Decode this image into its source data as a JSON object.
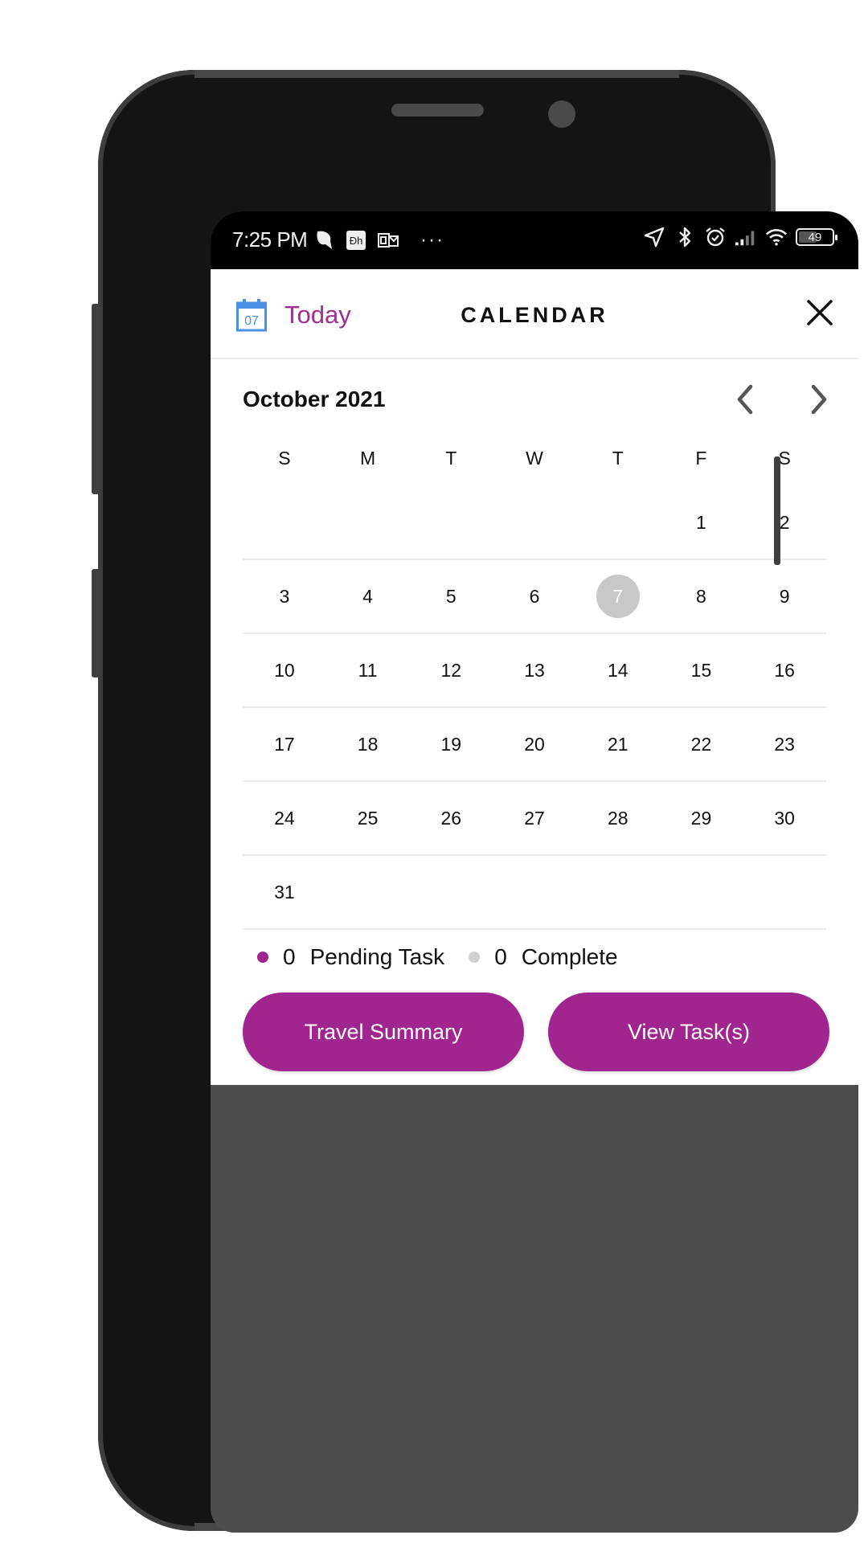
{
  "status_bar": {
    "time": "7:25 PM",
    "left_icons": [
      "messenger-icon",
      "app-dh-icon",
      "outlook-icon"
    ],
    "overflow": "···",
    "right_icons": [
      "location-icon",
      "bluetooth-icon",
      "alarm-icon",
      "signal-icon",
      "wifi-icon"
    ],
    "battery_level": "49",
    "battery_percent": 49
  },
  "header": {
    "today_icon_day": "07",
    "today_label": "Today",
    "title": "CALENDAR",
    "close_icon": "close-icon"
  },
  "calendar": {
    "month_label": "October 2021",
    "prev_icon": "chevron-left-icon",
    "next_icon": "chevron-right-icon",
    "weekdays": [
      "S",
      "M",
      "T",
      "W",
      "T",
      "F",
      "S"
    ],
    "selected_day": "7",
    "weeks": [
      [
        "",
        "",
        "",
        "",
        "",
        "1",
        "2"
      ],
      [
        "3",
        "4",
        "5",
        "6",
        "7",
        "8",
        "9"
      ],
      [
        "10",
        "11",
        "12",
        "13",
        "14",
        "15",
        "16"
      ],
      [
        "17",
        "18",
        "19",
        "20",
        "21",
        "22",
        "23"
      ],
      [
        "24",
        "25",
        "26",
        "27",
        "28",
        "29",
        "30"
      ],
      [
        "31",
        "",
        "",
        "",
        "",
        "",
        ""
      ]
    ]
  },
  "legend": {
    "pending_count": "0",
    "pending_label": "Pending Task",
    "pending_color": "#a0258f",
    "complete_count": "0",
    "complete_label": "Complete",
    "complete_color": "#d0d0d0"
  },
  "actions": {
    "travel_summary": "Travel Summary",
    "view_tasks": "View Task(s)"
  },
  "colors": {
    "accent": "#a0258f",
    "today_icon": "#4a90e2",
    "selected_day_bg": "#c8c8c8",
    "backdrop": "#4d4d4d"
  }
}
